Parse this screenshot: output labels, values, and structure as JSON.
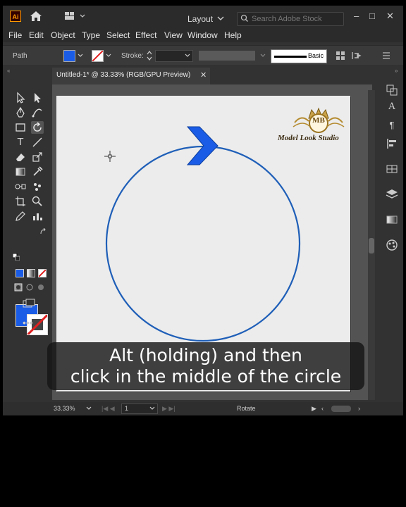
{
  "app": {
    "logo_text": "Ai",
    "layout_label": "Layout",
    "search_placeholder": "Search Adobe Stock",
    "window_buttons": [
      "–",
      "□",
      "✕"
    ]
  },
  "menu": [
    "File",
    "Edit",
    "Object",
    "Type",
    "Select",
    "Effect",
    "View",
    "Window",
    "Help"
  ],
  "control_bar": {
    "selection_type": "Path",
    "stroke_label": "Stroke:",
    "brush_label": "Basic",
    "fill_color": "#1a5ce6",
    "stroke_color": "none"
  },
  "document": {
    "tab_title": "Untitled-1* @ 33.33% (RGB/GPU Preview)",
    "close": "✕"
  },
  "statusbar": {
    "zoom": "33.33%",
    "artboard": "1",
    "tool_name": "Rotate"
  },
  "watermark": {
    "initials": "MB",
    "studio": "Model Look Studio"
  },
  "caption": {
    "line1": "Alt (holding) and then",
    "line2": "click in the middle of the circle"
  },
  "icons": {
    "cursor": "crosshair",
    "circle_stroke": "#1f5fb8",
    "arrow_fill": "#1a5ce6"
  }
}
